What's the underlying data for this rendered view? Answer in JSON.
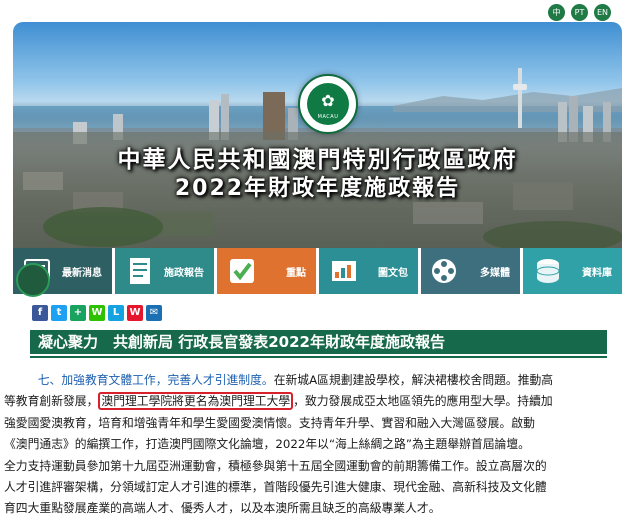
{
  "languages": [
    "中",
    "PT",
    "EN"
  ],
  "banner": {
    "logo_text": "MACAU",
    "title_line1": "中華人民共和國澳門特別行政區政府",
    "title_line2": "2022年財政年度施政報告"
  },
  "nav_tiles": [
    {
      "label": "最新消息",
      "icon": "news-icon"
    },
    {
      "label": "施政報告",
      "icon": "report-icon"
    },
    {
      "label": "重點",
      "icon": "checkmark-icon"
    },
    {
      "label": "圖文包",
      "icon": "infographic-icon"
    },
    {
      "label": "多媒體",
      "icon": "film-reel-icon"
    },
    {
      "label": "資料庫",
      "icon": "database-icon"
    }
  ],
  "share": [
    {
      "label": "f",
      "icon": "facebook-icon",
      "color": "#3b5998"
    },
    {
      "label": "t",
      "icon": "twitter-icon",
      "color": "#1da1f2"
    },
    {
      "label": "+",
      "icon": "share-plus-icon",
      "color": "#1aa260"
    },
    {
      "label": "W",
      "icon": "wechat-icon",
      "color": "#2dc100"
    },
    {
      "label": "L",
      "icon": "line-icon",
      "color": "#14a3e0"
    },
    {
      "label": "W",
      "icon": "weibo-icon",
      "color": "#e6162d"
    },
    {
      "label": "✉",
      "icon": "email-icon",
      "color": "#1b6fb3"
    }
  ],
  "heading": "凝心聚力　共創新局 行政長官發表2022年財政年度施政報告",
  "body": {
    "line1_lead": "七、加強教育文體工作，完善人才引進制度。",
    "line1_rest": "在新城A區規劃建設學校，解決裙樓校舍問題。推動高",
    "line2_pre": "等教育創新發展，",
    "line2_boxed": "澳門理工學院將更名為澳門理工大學",
    "line2_post": "，致力發展成亞太地區領先的應用型大學。持續加",
    "line3": "強愛國愛澳教育，培育和增強青年和學生愛國愛澳情懷。支持青年升學、實習和融入大灣區發展。啟動",
    "line4": "《澳門通志》的編撰工作，打造澳門國際文化論壇，2022年以“海上絲綢之路”為主題舉辦首屆論壇。",
    "line5": "全力支持運動員參加第十九屆亞洲運動會，積極參與第十五屆全國運動會的前期籌備工作。設立高層次的",
    "line6": "人才引進評審架構，分領域訂定人才引進的標準，首階段優先引進大健康、現代金融、高新科技及文化體",
    "line7": "育四大重點發展產業的高端人才、優秀人才，以及本澳所需且缺乏的高級專業人才。"
  },
  "colors": {
    "brand_green": "#16694a",
    "highlight_blue": "#1c5fb0",
    "box_red": "#d9212d"
  }
}
